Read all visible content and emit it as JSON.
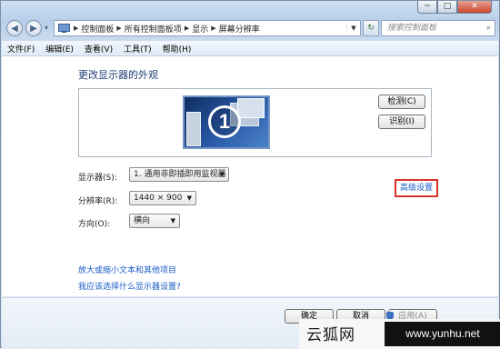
{
  "window": {
    "controls": {
      "minimize": "─",
      "maximize": "□",
      "close": "✕"
    }
  },
  "nav": {
    "back_icon": "back-arrow-icon",
    "forward_icon": "forward-arrow-icon",
    "breadcrumbs": [
      "控制面板",
      "所有控制面板项",
      "显示",
      "屏幕分辨率"
    ],
    "search_placeholder": "搜索控制面板"
  },
  "menu": [
    "文件(F)",
    "编辑(E)",
    "查看(V)",
    "工具(T)",
    "帮助(H)"
  ],
  "main": {
    "title": "更改显示器的外观",
    "monitor_number": "1",
    "detect_button": "检测(C)",
    "identify_button": "识别(I)",
    "display_label": "显示器(S):",
    "display_value": "1. 通用非即插即用监视器",
    "resolution_label": "分辨率(R):",
    "resolution_value": "1440 × 900",
    "orientation_label": "方向(O):",
    "orientation_value": "横向",
    "advanced_link": "高级设置",
    "link1": "放大或缩小文本和其他项目",
    "link2": "我应该选择什么显示器设置?"
  },
  "footer": {
    "ok_button": "确定",
    "cancel_button": "取消",
    "apply_button": "应用(A)"
  },
  "watermark": {
    "cn": "云狐网",
    "url": "www.yunhu.net"
  },
  "colors": {
    "link": "#1a5bc7",
    "highlight_box": "#d9322a",
    "title": "#1e3d78"
  }
}
